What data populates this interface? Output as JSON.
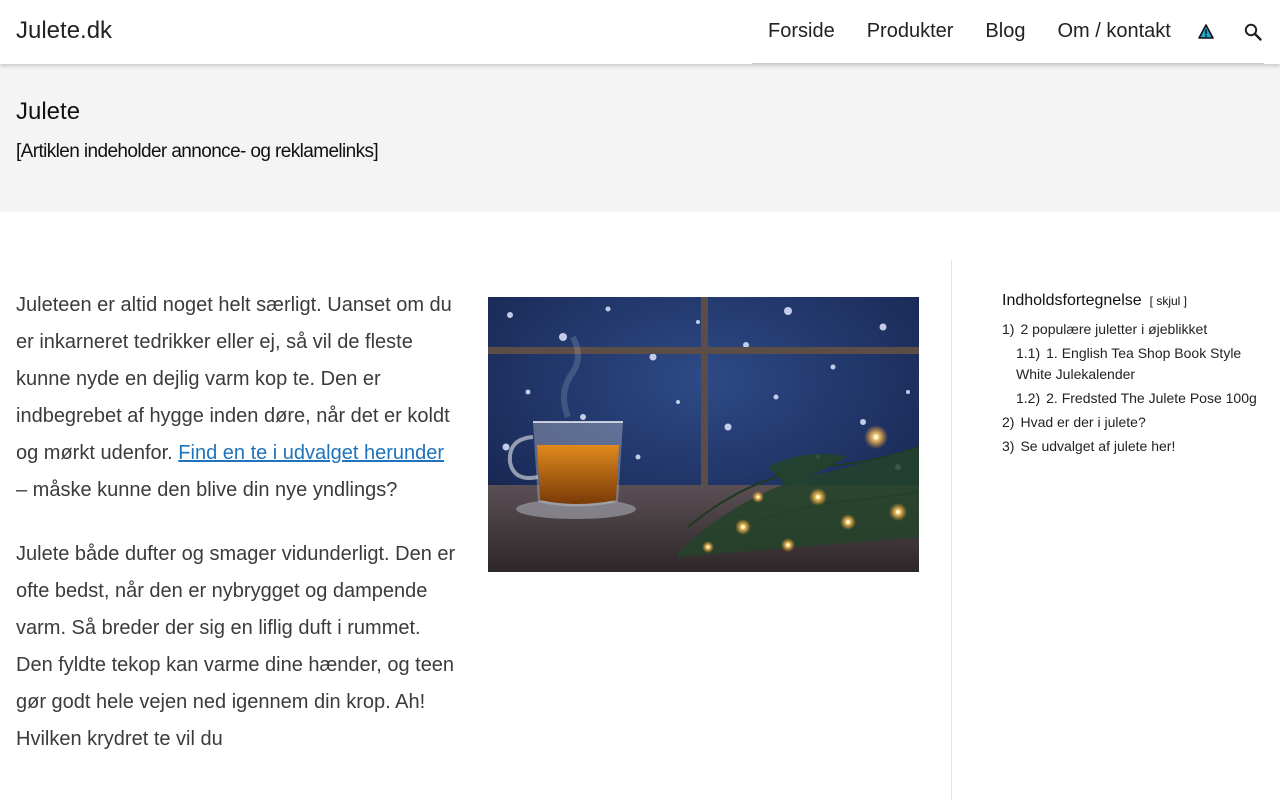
{
  "header": {
    "site_title": "Julete.dk",
    "nav": [
      "Forside",
      "Produkter",
      "Blog",
      "Om / kontakt"
    ],
    "icons": [
      "warning-triangle-icon",
      "search-icon"
    ]
  },
  "hero": {
    "title": "Julete",
    "disclaimer": "[Artiklen indeholder annonce- og reklamelinks]"
  },
  "article": {
    "p1_before_link": "Juleteen er altid noget helt særligt. Uanset om du er inkarneret tedrikker eller ej, så vil de fleste kunne nyde en dejlig varm kop te. Den er indbegrebet af hygge inden døre, når det er koldt og mørkt udenfor. ",
    "p1_link": "Find en te i udvalget herunder",
    "p1_after_link": " – måske kunne den blive din nye yndlings?",
    "p2": "Julete både dufter og smager vidunderligt. Den er ofte bedst, når den er nybrygget og dampende varm. Så breder der sig en liflig duft i rummet. Den fyldte tekop kan varme dine hænder, og teen gør godt hele vejen ned igennem din krop. Ah! Hvilken krydret te vil du"
  },
  "toc": {
    "title": "Indholdsfortegnelse",
    "toggle": "[ skjul ]",
    "items": [
      {
        "num": "1)",
        "label": "2 populære juletter i øjeblikket"
      },
      {
        "num": "1.1)",
        "label": "1. English Tea Shop Book Style White Julekalender"
      },
      {
        "num": "1.2)",
        "label": "2. Fredsted The Julete Pose 100g"
      },
      {
        "num": "2)",
        "label": "Hvad er der i julete?"
      },
      {
        "num": "3)",
        "label": "Se udvalget af julete her!"
      }
    ]
  },
  "colors": {
    "link": "#1e73be",
    "hero_bg": "#f4f4f4",
    "warning_icon": "#1ea5c8"
  }
}
